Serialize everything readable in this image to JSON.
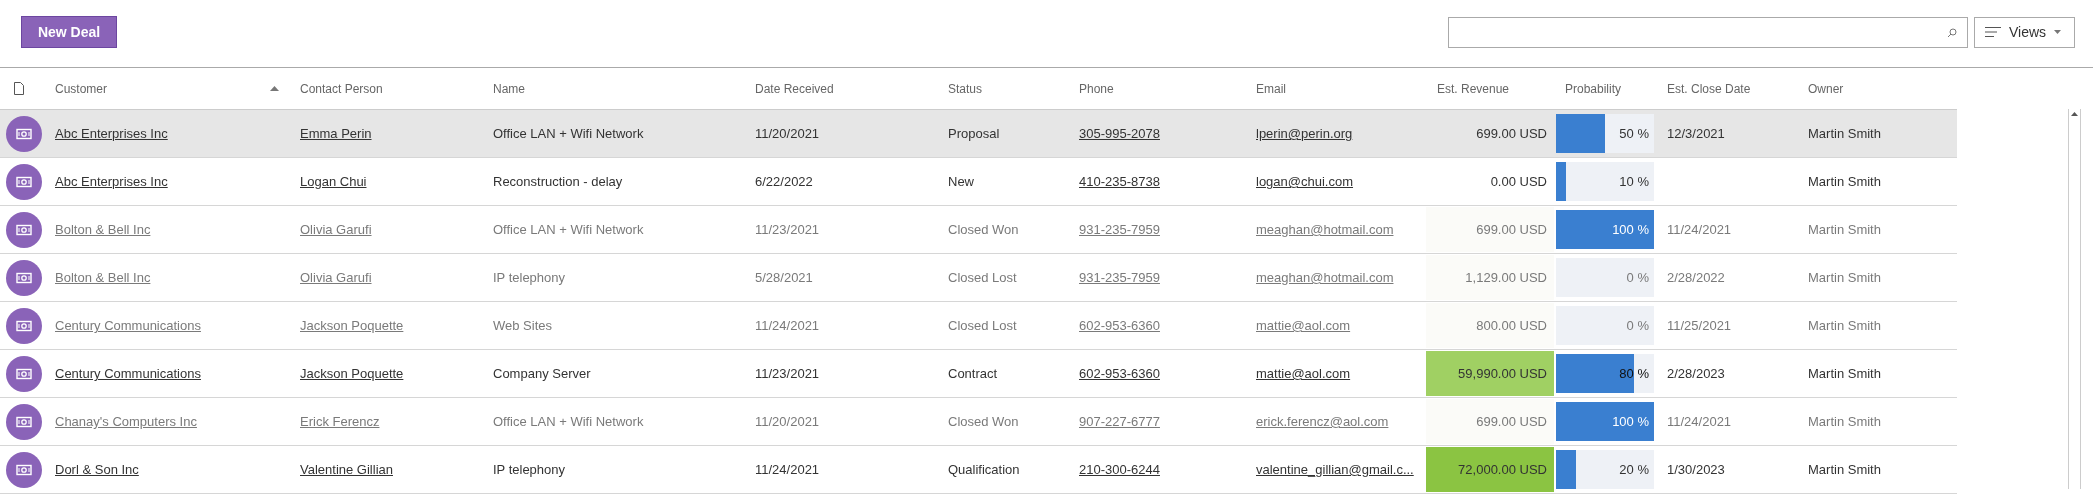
{
  "toolbar": {
    "new_button": "New Deal",
    "views_button": "Views"
  },
  "table": {
    "columns": [
      {
        "label": "Customer",
        "sorted": true
      },
      {
        "label": "Contact Person",
        "sorted": false
      },
      {
        "label": "Name",
        "sorted": false
      },
      {
        "label": "Date Received",
        "sorted": false
      },
      {
        "label": "Status",
        "sorted": false
      },
      {
        "label": "Phone",
        "sorted": false
      },
      {
        "label": "Email",
        "sorted": false
      },
      {
        "label": "Est. Revenue",
        "sorted": false
      },
      {
        "label": "Probability",
        "sorted": false
      },
      {
        "label": "Est. Close Date",
        "sorted": false
      },
      {
        "label": "Owner",
        "sorted": false
      }
    ],
    "rows": [
      {
        "selected": true,
        "closed": false,
        "customer": "Abc Enterprises Inc",
        "contact": "Emma Perin",
        "name": "Office LAN + Wifi Network",
        "date_received": "11/20/2021",
        "status": "Proposal",
        "phone": "305-995-2078",
        "email": "lperin@perin.org",
        "revenue": "699.00 USD",
        "level": 0.5,
        "probability": "50 %",
        "close_date": "12/3/2021",
        "owner": "Martin Smith"
      },
      {
        "selected": false,
        "closed": false,
        "customer": "Abc Enterprises Inc",
        "contact": "Logan Chui",
        "name": "Reconstruction - delay",
        "date_received": "6/22/2022",
        "status": "New",
        "phone": "410-235-8738",
        "email": "logan@chui.com",
        "revenue": "0.00 USD",
        "level": 0.1,
        "probability": "10 %",
        "owner": "Martin Smith"
      },
      {
        "selected": false,
        "closed": true,
        "customer": "Bolton & Bell Inc",
        "contact": "Olivia Garufi",
        "name": "Office LAN + Wifi Network",
        "date_received": "11/23/2021",
        "status": "Closed Won",
        "phone": "931-235-7959",
        "email": "meaghan@hotmail.com",
        "revenue": "699.00 USD",
        "level": 1,
        "probability": "100 %",
        "close_date": "11/24/2021",
        "owner": "Martin Smith"
      },
      {
        "selected": false,
        "closed": true,
        "customer": "Bolton & Bell Inc",
        "contact": "Olivia Garufi",
        "name": "IP telephony",
        "date_received": "5/28/2021",
        "status": "Closed Lost",
        "phone": "931-235-7959",
        "email": "meaghan@hotmail.com",
        "revenue": "1,129.00 USD",
        "level": 0,
        "probability": "0 %",
        "close_date": "2/28/2022",
        "owner": "Martin Smith"
      },
      {
        "selected": false,
        "closed": true,
        "customer": "Century Communications",
        "contact": "Jackson Poquette",
        "name": "Web Sites",
        "date_received": "11/24/2021",
        "status": "Closed Lost",
        "phone": "602-953-6360",
        "email": "mattie@aol.com",
        "revenue": "800.00 USD",
        "level": 0,
        "probability": "0 %",
        "close_date": "11/25/2021",
        "owner": "Martin Smith"
      },
      {
        "selected": false,
        "closed": false,
        "customer": "Century Communications",
        "contact": "Jackson Poquette",
        "name": "Company Server",
        "date_received": "11/23/2021",
        "status": "Contract",
        "phone": "602-953-6360",
        "email": "mattie@aol.com",
        "revenue": "59,990.00 USD",
        "color": "#a0d063",
        "level": 0.8,
        "probability": "80 %",
        "close_date": "2/28/2023",
        "owner": "Martin Smith"
      },
      {
        "selected": false,
        "closed": true,
        "customer": "Chanay's Computers Inc",
        "contact": "Erick Ferencz",
        "name": "Office LAN + Wifi Network",
        "date_received": "11/20/2021",
        "status": "Closed Won",
        "phone": "907-227-6777",
        "email": "erick.ferencz@aol.com",
        "revenue": "699.00 USD",
        "level": 1,
        "probability": "100 %",
        "close_date": "11/24/2021",
        "owner": "Martin Smith"
      },
      {
        "selected": false,
        "closed": false,
        "customer": "Dorl & Son Inc",
        "contact": "Valentine Gillian",
        "name": "IP telephony",
        "date_received": "11/24/2021",
        "status": "Qualification",
        "phone": "210-300-6244",
        "email": "valentine_gillian@gmail.c...",
        "revenue": "72,000.00 USD",
        "color": "#8bc442",
        "level": 0.2,
        "probability": "20 %",
        "close_date": "1/30/2023",
        "owner": "Martin Smith"
      }
    ]
  }
}
